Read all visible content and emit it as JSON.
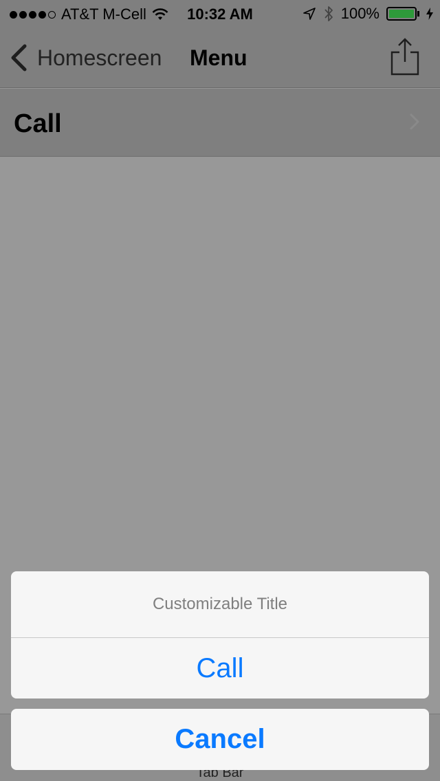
{
  "status_bar": {
    "carrier": "AT&T M-Cell",
    "time": "10:32 AM",
    "battery_percent": "100%",
    "battery_level": 1.0,
    "signal_bars": 4,
    "signal_max": 5
  },
  "nav_bar": {
    "back_label": "Homescreen",
    "title": "Menu"
  },
  "menu": {
    "items": [
      {
        "label": "Call"
      }
    ]
  },
  "tab_bar": {
    "label": "Tab Bar"
  },
  "action_sheet": {
    "title": "Customizable Title",
    "actions": [
      {
        "label": "Call"
      }
    ],
    "cancel_label": "Cancel"
  },
  "colors": {
    "accent": "#0a7aff",
    "battery": "#2e9a3a",
    "dim_overlay": "#989898"
  },
  "icons": {
    "back": "chevron-left-icon",
    "share": "share-icon",
    "disclosure": "chevron-right-icon",
    "location": "location-arrow-icon",
    "bluetooth": "bluetooth-icon",
    "wifi": "wifi-icon"
  }
}
